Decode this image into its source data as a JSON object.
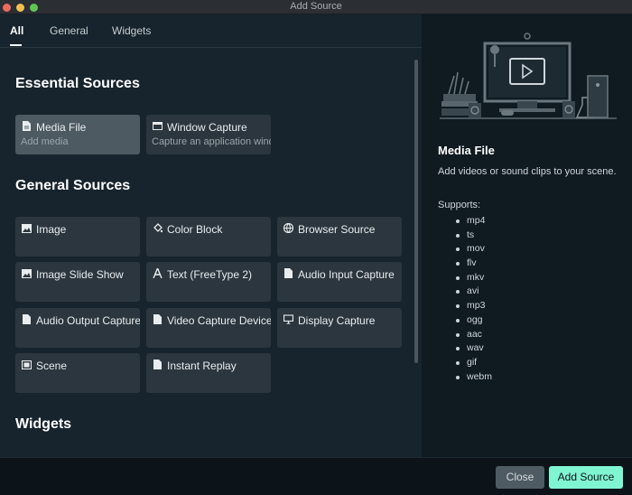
{
  "window": {
    "title": "Add Source"
  },
  "tabs": [
    {
      "label": "All"
    },
    {
      "label": "General"
    },
    {
      "label": "Widgets"
    }
  ],
  "essential": {
    "title": "Essential Sources",
    "items": [
      {
        "label": "Media File",
        "sub": "Add media",
        "icon": "file-icon"
      },
      {
        "label": "Window Capture",
        "sub": "Capture an application window",
        "icon": "window-icon"
      }
    ]
  },
  "general": {
    "title": "General Sources",
    "items": [
      {
        "label": "Image",
        "icon": "image-icon"
      },
      {
        "label": "Color Block",
        "icon": "paint-bucket-icon"
      },
      {
        "label": "Browser Source",
        "icon": "globe-icon"
      },
      {
        "label": "Image Slide Show",
        "icon": "image-icon"
      },
      {
        "label": "Text (FreeType 2)",
        "icon": "text-icon"
      },
      {
        "label": "Audio Input Capture",
        "icon": "file-icon"
      },
      {
        "label": "Audio Output Capture",
        "icon": "file-icon"
      },
      {
        "label": "Video Capture Device",
        "icon": "file-icon"
      },
      {
        "label": "Display Capture",
        "icon": "monitor-icon"
      },
      {
        "label": "Scene",
        "icon": "scene-icon"
      },
      {
        "label": "Instant Replay",
        "icon": "file-icon"
      }
    ]
  },
  "widgets": {
    "title": "Widgets"
  },
  "detail": {
    "title": "Media File",
    "description": "Add videos or sound clips to your scene.",
    "supports_label": "Supports:",
    "formats": [
      "mp4",
      "ts",
      "mov",
      "flv",
      "mkv",
      "avi",
      "mp3",
      "ogg",
      "aac",
      "wav",
      "gif",
      "webm"
    ]
  },
  "footer": {
    "close_label": "Close",
    "add_label": "Add Source"
  },
  "colors": {
    "accent": "#80f5d2",
    "panel": "#17242d",
    "card": "#2b363e",
    "card_selected": "#4e5a62"
  }
}
